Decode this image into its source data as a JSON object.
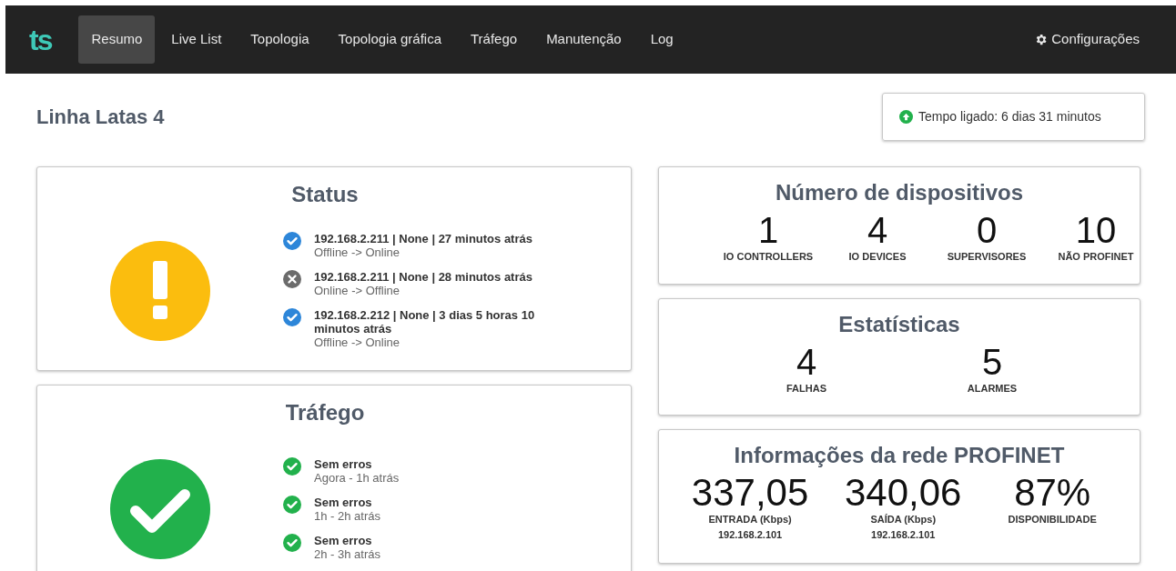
{
  "nav": {
    "logo": "ts",
    "items": [
      {
        "label": "Resumo",
        "selected": true
      },
      {
        "label": "Live List",
        "selected": false
      },
      {
        "label": "Topologia",
        "selected": false
      },
      {
        "label": "Topologia gráfica",
        "selected": false
      },
      {
        "label": "Tráfego",
        "selected": false
      },
      {
        "label": "Manutenção",
        "selected": false
      },
      {
        "label": "Log",
        "selected": false
      }
    ],
    "settings": "Configurações"
  },
  "page_title": "Linha Latas 4",
  "uptime": "Tempo ligado: 6 dias 31 minutos",
  "status_card": {
    "title": "Status",
    "kind": "warning",
    "events": [
      {
        "kind": "ok",
        "title": "192.168.2.211 | None | 27 minutos atrás",
        "detail": "Offline -> Online"
      },
      {
        "kind": "error",
        "title": "192.168.2.211 | None | 28 minutos atrás",
        "detail": "Online -> Offline"
      },
      {
        "kind": "ok",
        "title": "192.168.2.212 | None | 3 dias 5 horas 10 minutos atrás",
        "detail": "Offline -> Online"
      }
    ]
  },
  "traffic_card": {
    "title": "Tráfego",
    "kind": "ok",
    "events": [
      {
        "kind": "success",
        "title": "Sem erros",
        "detail": "Agora - 1h atrás"
      },
      {
        "kind": "success",
        "title": "Sem erros",
        "detail": "1h - 2h atrás"
      },
      {
        "kind": "success",
        "title": "Sem erros",
        "detail": "2h - 3h atrás"
      }
    ]
  },
  "devices_card": {
    "title": "Número de dispositivos",
    "stats": [
      {
        "value": "1",
        "label": "IO CONTROLLERS"
      },
      {
        "value": "4",
        "label": "IO DEVICES"
      },
      {
        "value": "0",
        "label": "SUPERVISORES"
      },
      {
        "value": "10",
        "label": "NÃO PROFINET"
      }
    ]
  },
  "stats_card": {
    "title": "Estatísticas",
    "stats": [
      {
        "value": "4",
        "label": "FALHAS"
      },
      {
        "value": "5",
        "label": "ALARMES"
      }
    ]
  },
  "network_card": {
    "title": "Informações da rede PROFINET",
    "stats": [
      {
        "value": "337,05",
        "label": "ENTRADA (Kbps)",
        "sub": "192.168.2.101"
      },
      {
        "value": "340,06",
        "label": "SAÍDA (Kbps)",
        "sub": "192.168.2.101"
      },
      {
        "value": "87%",
        "label": "DISPONIBILIDADE"
      }
    ]
  }
}
